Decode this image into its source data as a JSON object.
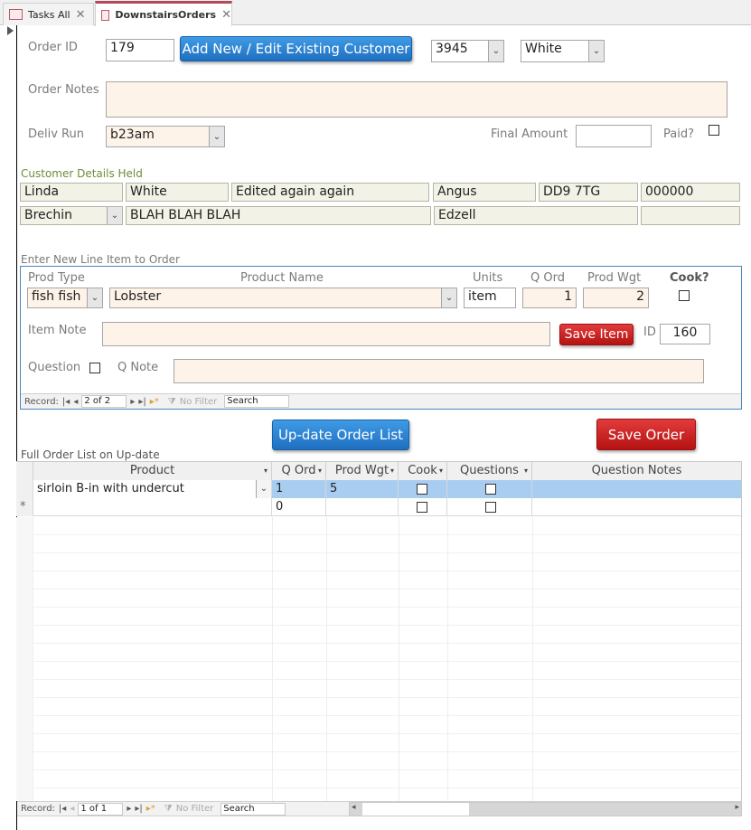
{
  "tabs": [
    {
      "label": "Tasks All",
      "active": false
    },
    {
      "label": "DownstairsOrders",
      "active": true
    }
  ],
  "order": {
    "id_label": "Order ID",
    "id_value": "179",
    "customer_button": "Add New / Edit Existing Customer",
    "combo1_value": "3945",
    "combo2_value": "White",
    "notes_label": "Order Notes",
    "notes_value": "",
    "deliv_label": "Deliv Run",
    "deliv_value": "b23am",
    "final_label": "Final Amount",
    "final_value": "",
    "paid_label": "Paid?",
    "paid_checked": false
  },
  "customer": {
    "section_label": "Customer Details Held",
    "row1": [
      "Linda",
      "White",
      "Edited again again",
      "Angus",
      "DD9 7TG",
      "000000"
    ],
    "row2": [
      "Brechin",
      "BLAH BLAH BLAH",
      "Edzell",
      ""
    ]
  },
  "line_item": {
    "section_label": "Enter New Line Item to Order",
    "prod_type_label": "Prod Type",
    "prod_type_value": "fish fish",
    "product_name_label": "Product Name",
    "product_name_value": "Lobster",
    "units_label": "Units",
    "units_value": "item",
    "qord_label": "Q Ord",
    "qord_value": "1",
    "prodwgt_label": "Prod Wgt",
    "prodwgt_value": "2",
    "cook_label": "Cook?",
    "cook_checked": false,
    "item_note_label": "Item Note",
    "save_item": "Save Item",
    "id_label": "ID",
    "id_value": "160",
    "question_label": "Question",
    "qnote_label": "Q Note",
    "nav": {
      "record_label": "Record:",
      "position": "2 of 2",
      "filter": "No Filter",
      "search": "Search"
    }
  },
  "buttons": {
    "update": "Up-date Order List",
    "save_order": "Save Order"
  },
  "order_list": {
    "section_label": "Full Order List on Up-date",
    "columns": [
      "Product",
      "Q Ord",
      "Prod Wgt",
      "Cook",
      "Questions",
      "Question Notes"
    ],
    "rows": [
      {
        "product": "sirloin B-in with undercut",
        "qord": "1",
        "prodwgt": "5",
        "cook": false,
        "questions": false,
        "notes": ""
      }
    ],
    "new_row": {
      "marker": "*",
      "qord": "0"
    },
    "nav": {
      "record_label": "Record:",
      "position": "1 of 1",
      "filter": "No Filter",
      "search": "Search"
    }
  },
  "colors": {
    "accent_blue": "#1f6fc0",
    "accent_red": "#b51212",
    "selected_row": "#a9cdf0",
    "section_green": "#6b8e3a"
  }
}
